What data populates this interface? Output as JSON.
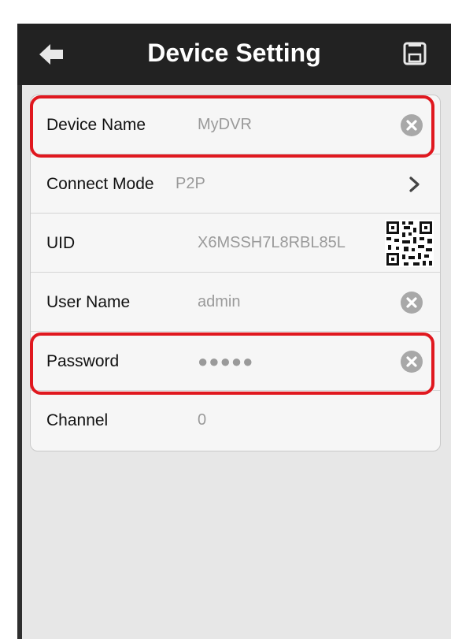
{
  "header": {
    "title": "Device Setting",
    "back_icon": "arrow-left-icon",
    "save_icon": "save-icon"
  },
  "form": {
    "rows": [
      {
        "label": "Device Name",
        "value": "MyDVR",
        "action": "clear-icon"
      },
      {
        "label": "Connect Mode",
        "value": "P2P",
        "action": "chevron-right-icon"
      },
      {
        "label": "UID",
        "value": "X6MSSH7L8RBL85L",
        "action": "qr-code-icon"
      },
      {
        "label": "User Name",
        "value": "admin",
        "action": "clear-icon"
      },
      {
        "label": "Password",
        "value": "●●●●●",
        "action": "clear-icon"
      },
      {
        "label": "Channel",
        "value": "0"
      }
    ]
  },
  "colors": {
    "navbar": "#222222",
    "highlight": "#e0181f",
    "panel": "#f6f6f6",
    "value_text": "#9a9a9a"
  }
}
